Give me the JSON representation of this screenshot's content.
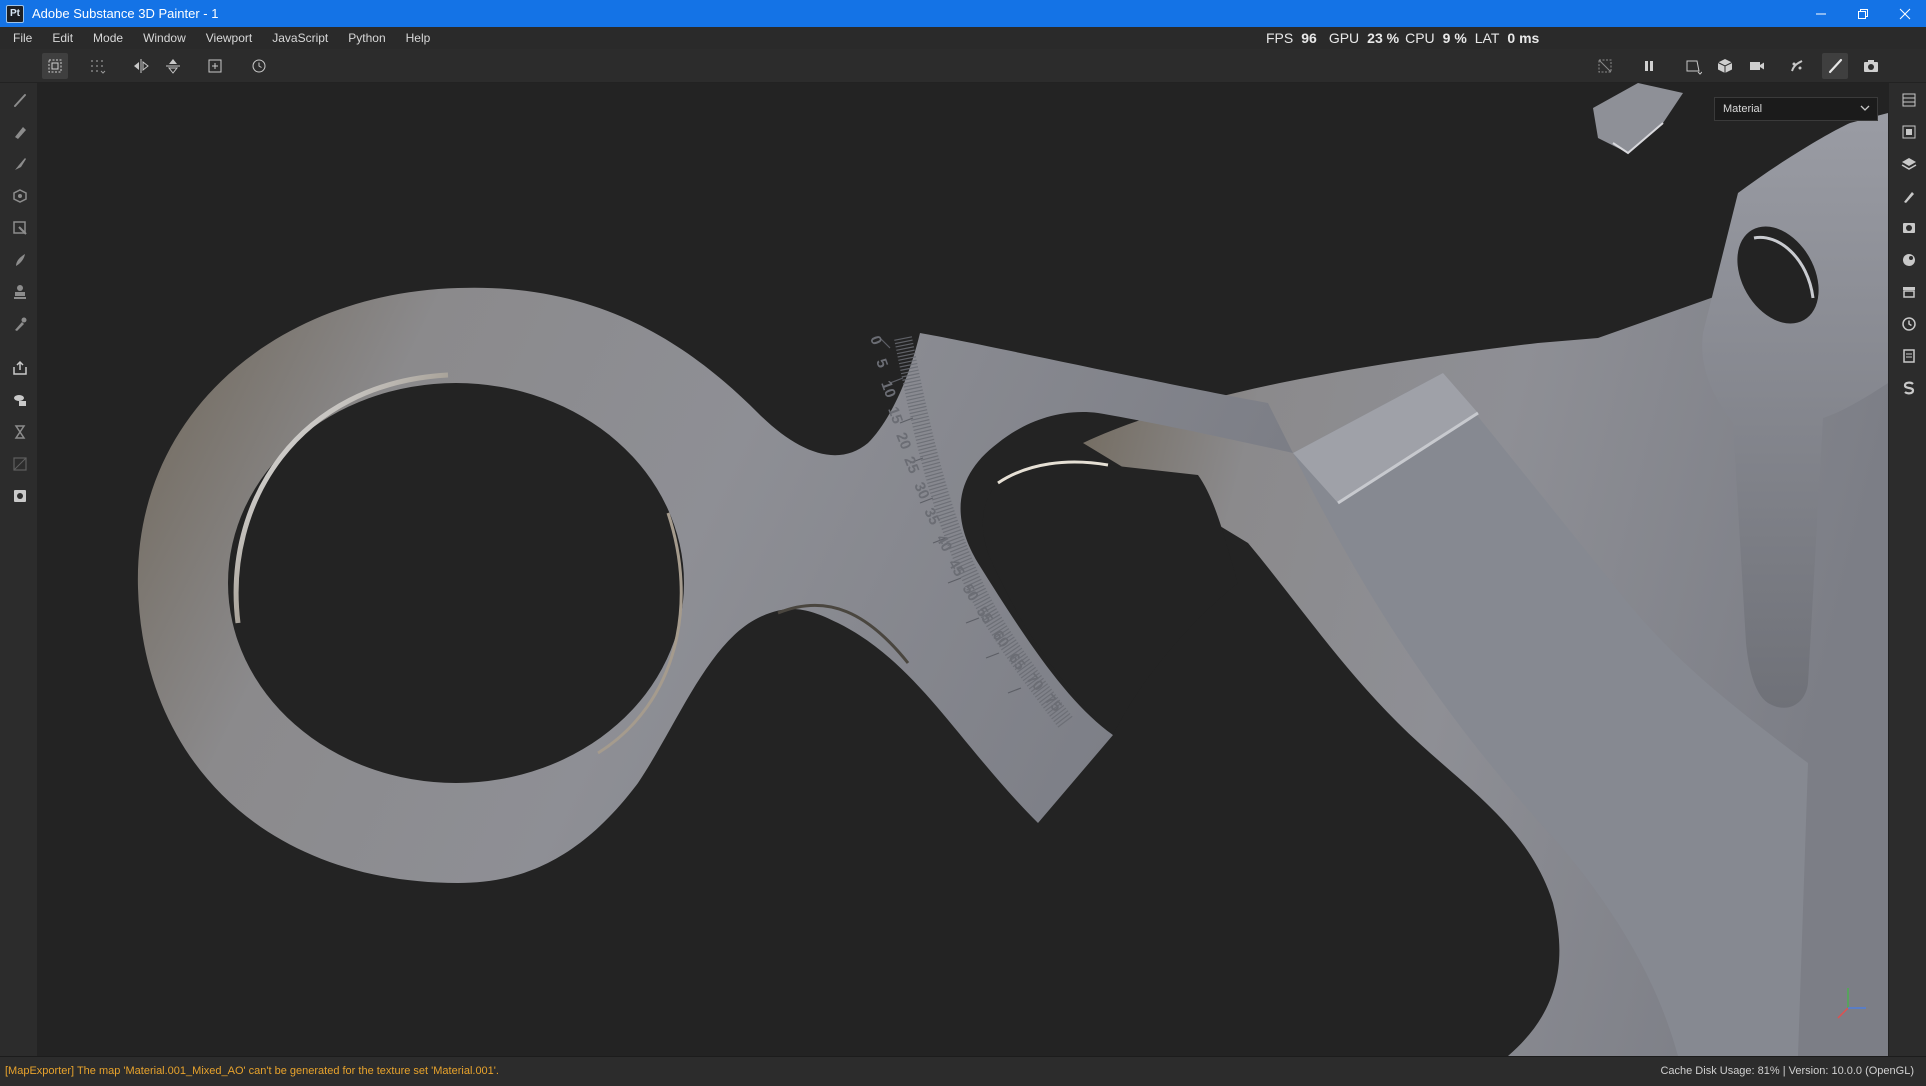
{
  "window": {
    "app_icon": "Pt",
    "title": "Adobe Substance 3D Painter - 1",
    "controls": [
      "minimize-icon",
      "restore-icon",
      "close-icon"
    ]
  },
  "menu": {
    "items": [
      "File",
      "Edit",
      "Mode",
      "Window",
      "Viewport",
      "JavaScript",
      "Python",
      "Help"
    ]
  },
  "performance": {
    "fps_label": "FPS",
    "fps_value": "96",
    "gpu_label": "GPU",
    "gpu_value": "23 %",
    "cpu_label": "CPU",
    "cpu_value": "9 %",
    "lat_label": "LAT",
    "lat_value": "0 ms"
  },
  "toolbar": {
    "left_tools": [
      "selection-mode-icon",
      "symmetry-dots-icon",
      "mirror-x-icon",
      "mirror-y-icon",
      "add-frame-icon",
      "reset-icon"
    ],
    "right_tools": [
      "hide-icon",
      "pause-icon",
      "viewport-display-icon",
      "cube-icon",
      "camera-icon",
      "seed-icon",
      "paint-brush-icon",
      "screenshot-icon"
    ]
  },
  "left_tools": [
    "paint-icon",
    "eraser-icon",
    "projection-icon",
    "geometry-fill-icon",
    "polygon-fill-icon",
    "smudge-icon",
    "clone-icon",
    "color-picker-icon",
    "export-icon",
    "bake-icon",
    "hourglass-icon",
    "disabled-icon",
    "ui-icon"
  ],
  "right_tools": [
    "texture-set-list-icon",
    "texture-set-settings-icon",
    "layers-icon",
    "properties-icon",
    "display-settings-icon",
    "shader-settings-icon",
    "assets-icon",
    "history-icon",
    "log-icon",
    "substance-icon"
  ],
  "viewport": {
    "mode_dropdown": "Material",
    "ruler_numbers": [
      "0",
      "5",
      "10",
      "15",
      "20",
      "25",
      "30",
      "35",
      "40",
      "45",
      "50",
      "55",
      "60",
      "65",
      "70",
      "75"
    ]
  },
  "statusbar": {
    "message": "[MapExporter] The map 'Material.001_Mixed_AO' can't be generated for the texture set 'Material.001'.",
    "cache": "Cache Disk Usage:    81% | Version: 10.0.0 (OpenGL)"
  },
  "colors": {
    "titlebar": "#1473e6",
    "panel": "#2c2c2c",
    "viewport": "#232323",
    "warning": "#e8a32c"
  }
}
